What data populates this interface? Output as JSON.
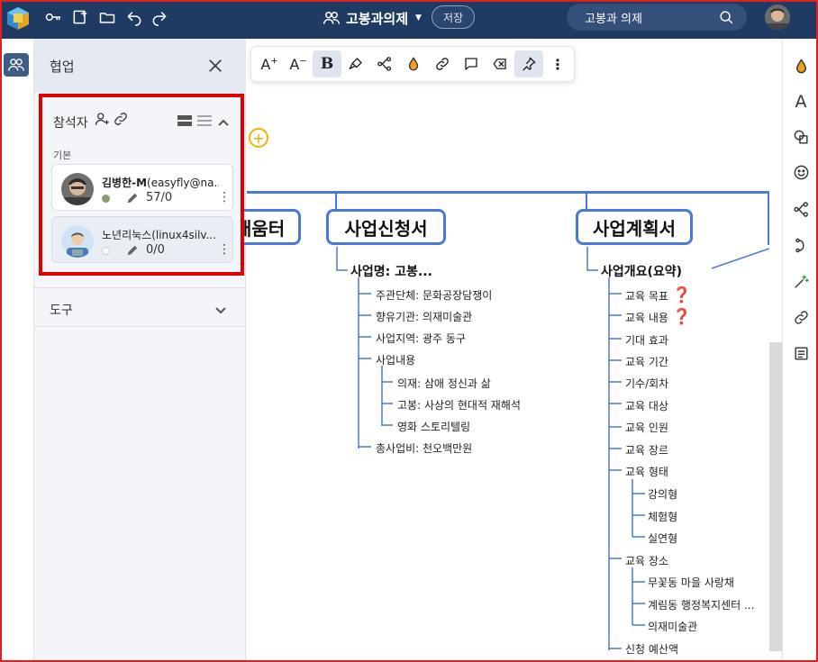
{
  "header": {
    "doc_title": "고봉과의제",
    "save_label": "저장",
    "search_value": "고봉과 의제"
  },
  "panel": {
    "title": "협업",
    "participants_label": "참석자",
    "group_label": "기본",
    "users": [
      {
        "name_bold": "김병한-M",
        "name_rest": "(easyfly@na...",
        "edit_count": "57/0",
        "status_color": "#8a9a6a"
      },
      {
        "name_bold": "",
        "name_rest": "노년리눅스(linux4silv...",
        "edit_count": "0/0",
        "status_color": "#ffffff"
      }
    ],
    "tools_label": "도구"
  },
  "toolbar": {
    "items": [
      "font-increase",
      "font-decrease",
      "bold",
      "brush",
      "branch",
      "fill-color",
      "link",
      "comment",
      "clear-format",
      "pin",
      "more"
    ],
    "bold_glyph": "B"
  },
  "mindmap": {
    "node_left_partial": "배움터",
    "node_mid": "사업신청서",
    "node_right": "사업계획서",
    "mid_sub": "사업명: 고봉...",
    "mid_leaves": [
      "주관단체: 문화공장담쟁이",
      "향유기관: 의재미술관",
      "사업지역: 광주 동구",
      "사업내용",
      "의재: 삼애 정신과 삶",
      "고봉: 사상의 현대적 재해석",
      "영화 스토리텔링",
      "총사업비: 천오백만원"
    ],
    "right_sub": "사업개요(요약)",
    "right_leaves": [
      "교육 목표",
      "교육 내용",
      "기대 효과",
      "교육 기간",
      "기수/회차",
      "교육 대상",
      "교육 인원",
      "교육 장르",
      "교육 형태",
      "강의형",
      "체험형",
      "실연형",
      "교육 장소",
      "무꽃동 마을 사랑채",
      "계림동 행정복지센터 ...",
      "의재미술관",
      "신청 예산액"
    ],
    "question_mark": "❓"
  },
  "colors": {
    "topbar": "#1f3b63",
    "accent": "#4a79d8",
    "highlight": "#e00000"
  }
}
